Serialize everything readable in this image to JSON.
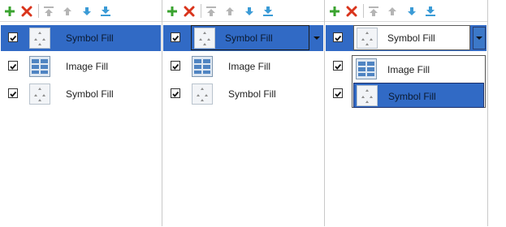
{
  "toolbar": {
    "buttons": [
      {
        "icon": "add-icon",
        "tooltip": "Add"
      },
      {
        "icon": "delete-icon",
        "tooltip": "Delete"
      },
      {
        "icon": "move-top-icon",
        "tooltip": "Move to top"
      },
      {
        "icon": "move-up-icon",
        "tooltip": "Move up"
      },
      {
        "icon": "move-down-icon",
        "tooltip": "Move down"
      },
      {
        "icon": "move-bottom-icon",
        "tooltip": "Move to bottom"
      }
    ]
  },
  "panels": [
    {
      "layers": [
        {
          "label": "Symbol Fill",
          "checked": true,
          "selected": true
        },
        {
          "label": "Image Fill",
          "checked": true,
          "selected": false
        },
        {
          "label": "Symbol Fill",
          "checked": true,
          "selected": false
        }
      ]
    },
    {
      "combo": {
        "value": "Symbol Fill"
      },
      "layers": [
        {
          "label": "Symbol Fill",
          "checked": true,
          "selected": true
        },
        {
          "label": "Image Fill",
          "checked": true,
          "selected": false
        },
        {
          "label": "Symbol Fill",
          "checked": true,
          "selected": false
        }
      ]
    },
    {
      "combo": {
        "value": "Symbol Fill"
      },
      "dropdown_options": [
        "Image Fill",
        "Symbol Fill"
      ],
      "dropdown_selected": "Symbol Fill",
      "layers": [
        {
          "label": "Symbol Fill",
          "checked": true,
          "selected": true
        },
        {
          "label": "Image Fill",
          "checked": true,
          "selected": false
        },
        {
          "label": "Symbol Fill",
          "checked": true,
          "selected": false
        }
      ]
    }
  ],
  "colors": {
    "selection": "#316ac5",
    "add": "#3aa32f",
    "delete": "#d9341c",
    "arrows_active": "#3b9bd6",
    "arrows_inactive": "#b5b5b5"
  }
}
